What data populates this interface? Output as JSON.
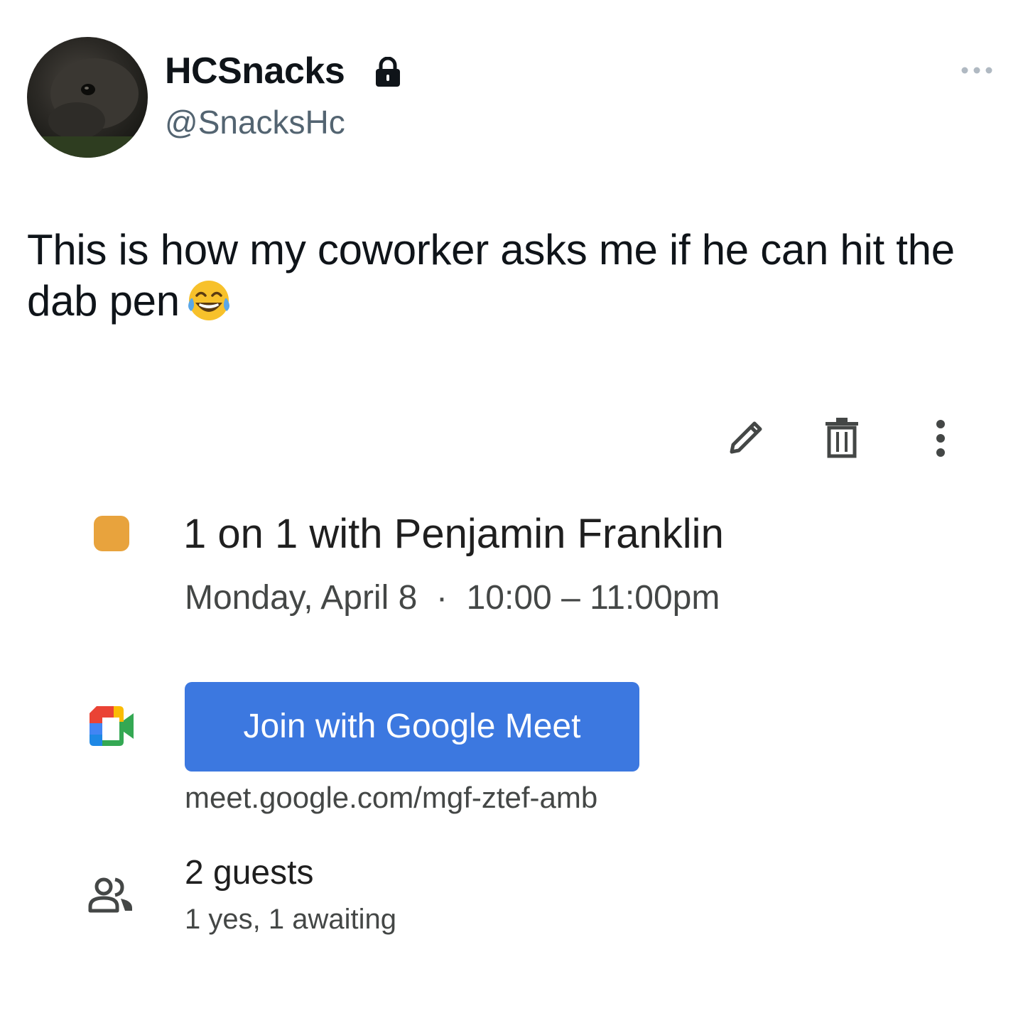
{
  "tweet": {
    "display_name": "HCSnacks",
    "handle": "@SnacksHc",
    "protected_icon": "lock-icon",
    "more_icon": "more-horizontal-icon",
    "text": "This is how my coworker asks me if he can hit the dab pen",
    "emoji": "face-with-tears-of-joy-icon"
  },
  "calendar_event": {
    "toolbar": {
      "edit_icon": "pencil-icon",
      "delete_icon": "trash-icon",
      "more_icon": "more-vertical-icon"
    },
    "color": "#e8a33d",
    "title": "1 on 1 with Penjamin Franklin",
    "date": "Monday, April 8",
    "separator": "·",
    "time": "10:00 – 11:00pm",
    "meet_button_label": "Join with Google Meet",
    "meet_link": "meet.google.com/mgf-ztef-amb",
    "guests_count": "2 guests",
    "guests_status": "1 yes, 1 awaiting"
  },
  "colors": {
    "meet_blue": "#3c78e0",
    "handle_grey": "#536471",
    "event_orange": "#e8a33d"
  }
}
